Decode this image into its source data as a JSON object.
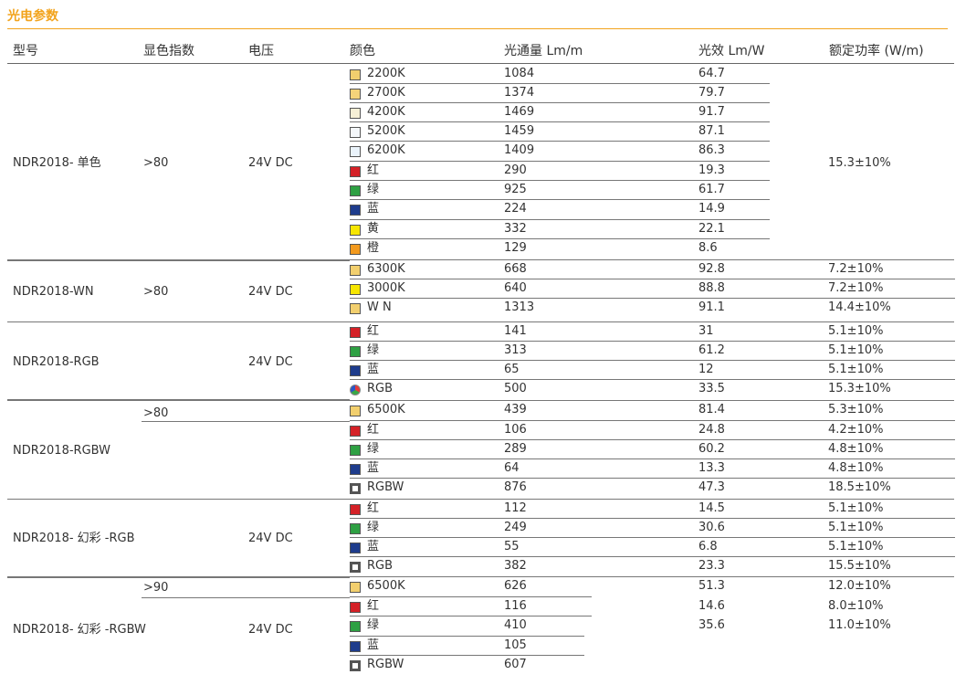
{
  "title": "光电参数",
  "headers": [
    "型号",
    "显色指数",
    "电压",
    "颜色",
    "光通量 Lm/m",
    "光效 Lm/W",
    "额定功率 (W/m)"
  ],
  "models": [
    {
      "name": "NDR2018- 单色",
      "cri": ">80",
      "voltage": "24V DC"
    },
    {
      "name": "NDR2018-WN",
      "cri": ">80",
      "voltage": "24V DC"
    },
    {
      "name": "NDR2018-RGB",
      "cri": "",
      "voltage": "24V DC"
    },
    {
      "name": "NDR2018-RGBW",
      "cri": ">80",
      "voltage": ""
    },
    {
      "name": "NDR2018- 幻彩 -RGB",
      "cri": "",
      "voltage": "24V DC"
    },
    {
      "name": "NDR2018- 幻彩 -RGBW",
      "cri": ">90",
      "voltage": "24V DC"
    }
  ],
  "rows": [
    {
      "color": "2200K",
      "swatch": "#f2cf6e",
      "lumen": "1084",
      "eff": "64.7",
      "power": ""
    },
    {
      "color": "2700K",
      "swatch": "#f4d37a",
      "lumen": "1374",
      "eff": "79.7",
      "power": ""
    },
    {
      "color": "4200K",
      "swatch": "#f7f0d6",
      "lumen": "1469",
      "eff": "91.7",
      "power": ""
    },
    {
      "color": "5200K",
      "swatch": "#f4f7fa",
      "lumen": "1459",
      "eff": "87.1",
      "power": ""
    },
    {
      "color": "6200K",
      "swatch": "#eaf3fb",
      "lumen": "1409",
      "eff": "86.3",
      "power": ""
    },
    {
      "color": "红",
      "swatch": "#d42127",
      "lumen": "290",
      "eff": "19.3",
      "power": ""
    },
    {
      "color": "绿",
      "swatch": "#2ea043",
      "lumen": "925",
      "eff": "61.7",
      "power": ""
    },
    {
      "color": "蓝",
      "swatch": "#1e3c8c",
      "lumen": "224",
      "eff": "14.9",
      "power": ""
    },
    {
      "color": "黄",
      "swatch": "#f7e600",
      "lumen": "332",
      "eff": "22.1",
      "power": ""
    },
    {
      "color": "橙",
      "swatch": "#f39a1e",
      "lumen": "129",
      "eff": "8.6",
      "power": ""
    },
    {
      "color": "6300K",
      "swatch": "#f2cf6e",
      "lumen": "668",
      "eff": "92.8",
      "power": "7.2±10%"
    },
    {
      "color": "3000K",
      "swatch": "#f7e600",
      "lumen": "640",
      "eff": "88.8",
      "power": "7.2±10%"
    },
    {
      "color": "W N",
      "swatch": "#f2cf6e",
      "lumen": "1313",
      "eff": "91.1",
      "power": "14.4±10%"
    },
    {
      "color": "红",
      "swatch": "#d42127",
      "lumen": "141",
      "eff": "31",
      "power": "5.1±10%"
    },
    {
      "color": "绿",
      "swatch": "#2ea043",
      "lumen": "313",
      "eff": "61.2",
      "power": "5.1±10%"
    },
    {
      "color": "蓝",
      "swatch": "#1e3c8c",
      "lumen": "65",
      "eff": "12",
      "power": "5.1±10%"
    },
    {
      "color": "RGB",
      "swatch": "rgb",
      "lumen": "500",
      "eff": "33.5",
      "power": "15.3±10%"
    },
    {
      "color": "6500K",
      "swatch": "#f2cf6e",
      "lumen": "439",
      "eff": "81.4",
      "power": "5.3±10%"
    },
    {
      "color": "红",
      "swatch": "#d42127",
      "lumen": "106",
      "eff": "24.8",
      "power": "4.2±10%"
    },
    {
      "color": "绿",
      "swatch": "#2ea043",
      "lumen": "289",
      "eff": "60.2",
      "power": "4.8±10%"
    },
    {
      "color": "蓝",
      "swatch": "#1e3c8c",
      "lumen": "64",
      "eff": "13.3",
      "power": "4.8±10%"
    },
    {
      "color": "RGBW",
      "swatch": "white",
      "lumen": "876",
      "eff": "47.3",
      "power": "18.5±10%"
    },
    {
      "color": "红",
      "swatch": "#d42127",
      "lumen": "112",
      "eff": "14.5",
      "power": "5.1±10%"
    },
    {
      "color": "绿",
      "swatch": "#2ea043",
      "lumen": "249",
      "eff": "30.6",
      "power": "5.1±10%"
    },
    {
      "color": "蓝",
      "swatch": "#1e3c8c",
      "lumen": "55",
      "eff": "6.8",
      "power": "5.1±10%"
    },
    {
      "color": "RGB",
      "swatch": "white",
      "lumen": "382",
      "eff": "23.3",
      "power": "15.5±10%"
    },
    {
      "color": "6500K",
      "swatch": "#f2cf6e",
      "lumen": "626",
      "eff": "51.3",
      "power": "12.0±10%"
    },
    {
      "color": "红",
      "swatch": "#d42127",
      "lumen": "116",
      "eff": "14.6",
      "power": "8.0±10%"
    },
    {
      "color": "绿",
      "swatch": "#2ea043",
      "lumen": "410",
      "eff": "35.6",
      "power": "11.0±10%"
    },
    {
      "color": "蓝",
      "swatch": "#1e3c8c",
      "lumen": "105",
      "eff": "",
      "power": ""
    },
    {
      "color": "RGBW",
      "swatch": "white",
      "lumen": "607",
      "eff": "",
      "power": ""
    }
  ],
  "merged_power": "15.3±10%"
}
